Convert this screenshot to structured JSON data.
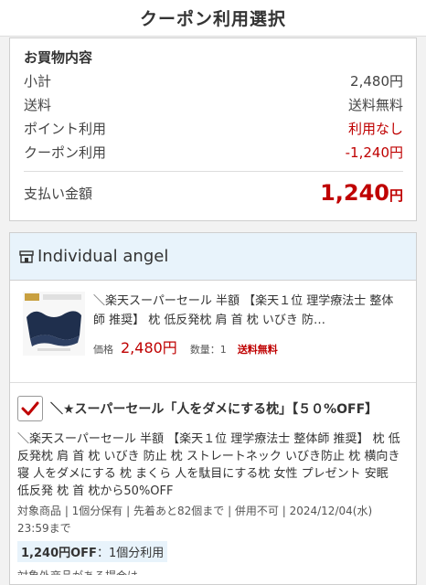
{
  "header": {
    "title": "クーポン利用選択"
  },
  "summary": {
    "title": "お買物内容",
    "rows": [
      {
        "label": "小計",
        "value": "2,480円"
      },
      {
        "label": "送料",
        "value": "送料無料"
      },
      {
        "label": "ポイント利用",
        "value": "利用なし"
      },
      {
        "label": "クーポン利用",
        "value": "-1,240円"
      }
    ],
    "total_label": "支払い金額",
    "total_value": "1,240",
    "total_unit": "円"
  },
  "shop": {
    "name": "Individual angel",
    "product": {
      "description": "＼楽天スーパーセール 半額 【楽天１位 理学療法士 整体師 推奨】 枕 低反発枕 肩 首 枕 いびき 防…",
      "price_label": "価格",
      "price": "2,480円",
      "qty": "数量：1",
      "shipping": "送料無料"
    }
  },
  "coupon": {
    "checked": true,
    "title": "＼★スーパーセール「人をダメにする枕」【５０%OFF】",
    "description": "＼楽天スーパーセール 半額 【楽天１位 理学療法士 整体師 推奨】 枕 低反発枕 肩 首 枕 いびき 防止 枕 ストレートネック いびき防止 枕 横向き寝 人をダメにする 枕 まくら 人を駄目にする枕 女性 プレゼント 安眠 低反発 枕 首 枕から50%OFF",
    "meta": "対象商品 | 1個分保有 | 先着あと82個まで | 併用不可 | 2024/12/04(水) 23:59まで",
    "badge_amount": "1,240円OFF",
    "badge_note": "：1個分利用",
    "tail": "対象外商品がある場合は..."
  },
  "colors": {
    "accent_red": "#bf0000",
    "shop_header_bg": "#e8f3fb"
  }
}
